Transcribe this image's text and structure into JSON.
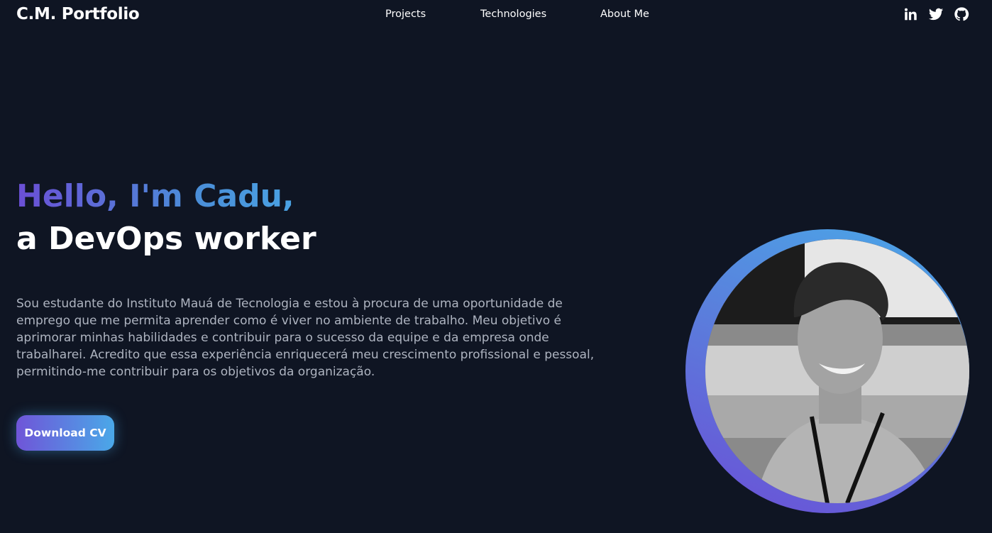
{
  "nav": {
    "brand": "C.M. Portfolio",
    "links": [
      "Projects",
      "Technologies",
      "About Me"
    ],
    "social": [
      "linkedin-icon",
      "twitter-icon",
      "github-icon"
    ]
  },
  "hero": {
    "greeting": "Hello, I'm Cadu,",
    "role": "a DevOps worker",
    "intro": "Sou estudante do Instituto Mauá de Tecnologia e estou à procura de uma oportunidade de emprego que me permita aprender como é viver no ambiente de trabalho. Meu objetivo é aprimorar minhas habilidades e contribuir para o sucesso da equipe e da empresa onde trabalharei. Acredito que essa experiência enriquecerá meu crescimento profissional e pessoal, permitindo-me contribuir para os objetivos da organização.",
    "download_label": "Download CV"
  },
  "colors": {
    "background": "#0f1523",
    "gradient_start": "#6b4fd6",
    "gradient_end": "#4aa8e8",
    "muted_text": "#aeb4c0"
  }
}
